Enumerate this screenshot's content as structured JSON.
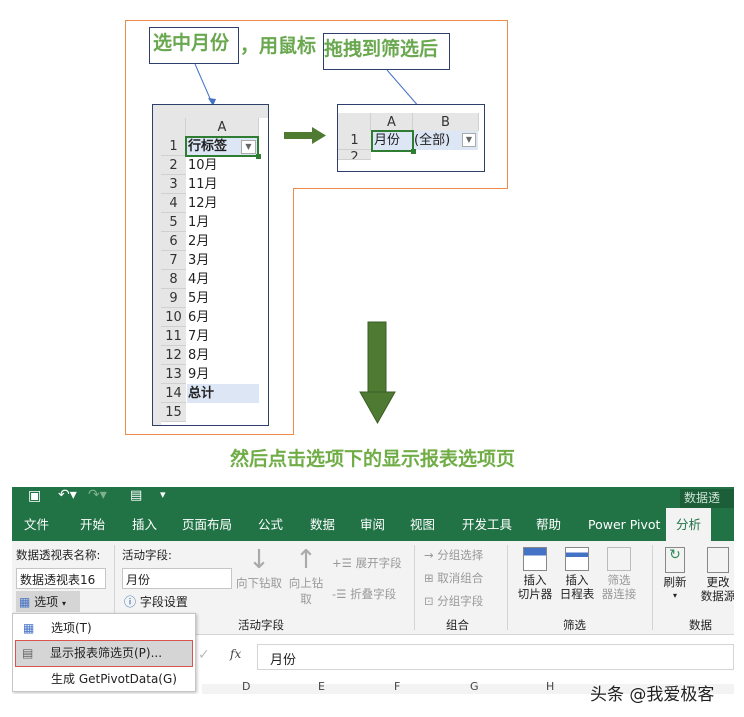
{
  "instructions": {
    "callout_left": "选中月份",
    "callout_comma": "，",
    "callout_mid": "用鼠标",
    "callout_right": "拖拽到筛选后",
    "caption": "然后点击选项下的显示报表选项页"
  },
  "left_sheet": {
    "column": "A",
    "rows": [
      {
        "n": "1",
        "v": "行标签"
      },
      {
        "n": "2",
        "v": "10月"
      },
      {
        "n": "3",
        "v": "11月"
      },
      {
        "n": "4",
        "v": "12月"
      },
      {
        "n": "5",
        "v": "1月"
      },
      {
        "n": "6",
        "v": "2月"
      },
      {
        "n": "7",
        "v": "3月"
      },
      {
        "n": "8",
        "v": "4月"
      },
      {
        "n": "9",
        "v": "5月"
      },
      {
        "n": "10",
        "v": "6月"
      },
      {
        "n": "11",
        "v": "7月"
      },
      {
        "n": "12",
        "v": "8月"
      },
      {
        "n": "13",
        "v": "9月"
      },
      {
        "n": "14",
        "v": "总计"
      },
      {
        "n": "15",
        "v": ""
      }
    ]
  },
  "right_sheet": {
    "col_a": "A",
    "col_b": "B",
    "row1": "1",
    "row2": "2",
    "a1": "月份",
    "b1": "(全部)"
  },
  "excel": {
    "title": "数据透视",
    "tabs": [
      "文件",
      "开始",
      "插入",
      "页面布局",
      "公式",
      "数据",
      "审阅",
      "视图",
      "开发工具",
      "帮助",
      "Power Pivot",
      "分析"
    ],
    "active_tab": "分析",
    "pivot_name_label": "数据透视表名称:",
    "pivot_name_value": "数据透视表16",
    "options_button": "选项",
    "active_field_label": "活动字段:",
    "active_field_value": "月份",
    "field_settings": "字段设置",
    "drill_down": "向下钻取",
    "drill_up_1": "向上钻",
    "drill_up_2": "取",
    "expand_field": "展开字段",
    "collapse_field": "折叠字段",
    "group_active_field": "活动字段",
    "group_selection": "分组选择",
    "ungroup": "取消组合",
    "group_field": "分组字段",
    "group_group": "组合",
    "insert_slicer_1": "插入",
    "insert_slicer_2": "切片器",
    "insert_timeline_1": "插入",
    "insert_timeline_2": "日程表",
    "filter_conn_1": "筛选",
    "filter_conn_2": "器连接",
    "group_filter": "筛选",
    "refresh": "刷新",
    "change_source_1": "更改",
    "change_source_2": "数据源",
    "group_data": "数据",
    "menu": [
      "选项(T)",
      "显示报表筛选页(P)...",
      "生成 GetPivotData(G)"
    ],
    "fx": "fx",
    "formula_value": "月份",
    "col_headers": [
      "D",
      "E",
      "F",
      "G",
      "H"
    ]
  },
  "watermark": "头条 @我爱极客",
  "colors": {
    "excel_green": "#217346",
    "caption_green": "#70ad47",
    "arrow_green": "#4e7a32",
    "orange": "#ed8b4a"
  }
}
